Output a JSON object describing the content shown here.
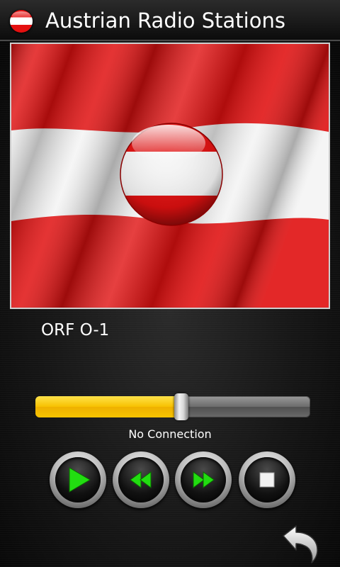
{
  "header": {
    "title": "Austrian Radio Stations",
    "logo_icon": "austria-flag-ball-icon"
  },
  "flag": {
    "icon": "austria-waving-flag-icon",
    "colors": {
      "red": "#e01010",
      "white": "#f4f4f4"
    }
  },
  "player": {
    "station_name": "ORF O-1",
    "status": "No Connection",
    "progress_percent": 53,
    "accent_color": "#f7c100"
  },
  "controls": {
    "play_icon": "play-icon",
    "rewind_icon": "rewind-icon",
    "forward_icon": "fast-forward-icon",
    "stop_icon": "stop-icon",
    "icon_color": "#22dd11"
  },
  "nav": {
    "back_icon": "back-arrow-icon"
  }
}
